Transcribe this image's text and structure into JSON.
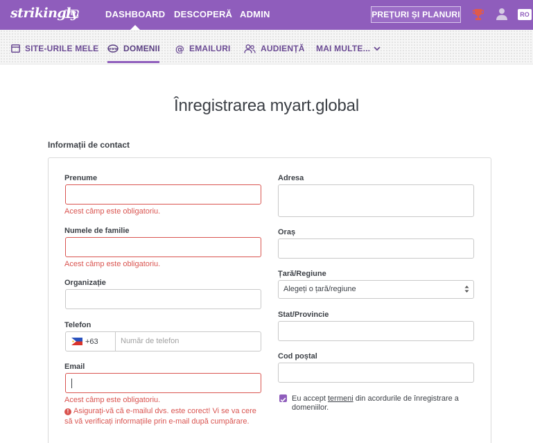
{
  "topbar": {
    "logo": "strikingly",
    "vip_badge": "VIP",
    "nav": [
      "DASHBOARD",
      "DESCOPERĂ",
      "ADMIN"
    ],
    "active_nav": "DASHBOARD",
    "pricing_button": "PREȚURI ȘI PLANURI",
    "language": "RO",
    "icons": [
      "trophy-icon",
      "user-icon"
    ]
  },
  "subnav": {
    "items": [
      {
        "label": "SITE-URILE MELE",
        "icon": "site-icon"
      },
      {
        "label": "DOMENII",
        "icon": "domain-icon"
      },
      {
        "label": "EMAILURI",
        "icon": "at-icon"
      },
      {
        "label": "AUDIENȚĂ",
        "icon": "audience-icon"
      },
      {
        "label": "MAI MULTE...",
        "icon": "chevron-down-icon"
      }
    ],
    "active": "DOMENII"
  },
  "page": {
    "title": "Înregistrarea myart.global",
    "section_title": "Informații de contact"
  },
  "form": {
    "first_name": {
      "label": "Prenume",
      "value": "",
      "error": "Acest câmp este obligatoriu."
    },
    "last_name": {
      "label": "Numele de familie",
      "value": "",
      "error": "Acest câmp este obligatoriu."
    },
    "organization": {
      "label": "Organizație",
      "value": ""
    },
    "phone": {
      "label": "Telefon",
      "country_code": "+63",
      "placeholder": "Număr de telefon",
      "value": ""
    },
    "email": {
      "label": "Email",
      "value": "",
      "error": "Acest câmp este obligatoriu.",
      "warning": "Asigurați-vă că e-mailul dvs. este corect! Vi se va cere să vă verificați informațiile prin e-mail după cumpărare."
    },
    "address": {
      "label": "Adresa",
      "value": ""
    },
    "city": {
      "label": "Oraș",
      "value": ""
    },
    "country": {
      "label": "Țară/Regiune",
      "selected": "Alegeți o țară/regiune"
    },
    "state": {
      "label": "Stat/Provincie",
      "value": ""
    },
    "postal_code": {
      "label": "Cod poștal",
      "value": ""
    },
    "terms": {
      "checked": true,
      "text_before": "Eu accept ",
      "link": "termeni",
      "text_after": " din acordurile de înregistrare a domeniilor."
    }
  },
  "colors": {
    "brand": "#8f5dbc",
    "error": "#d9534f",
    "text": "#3b3f45"
  }
}
